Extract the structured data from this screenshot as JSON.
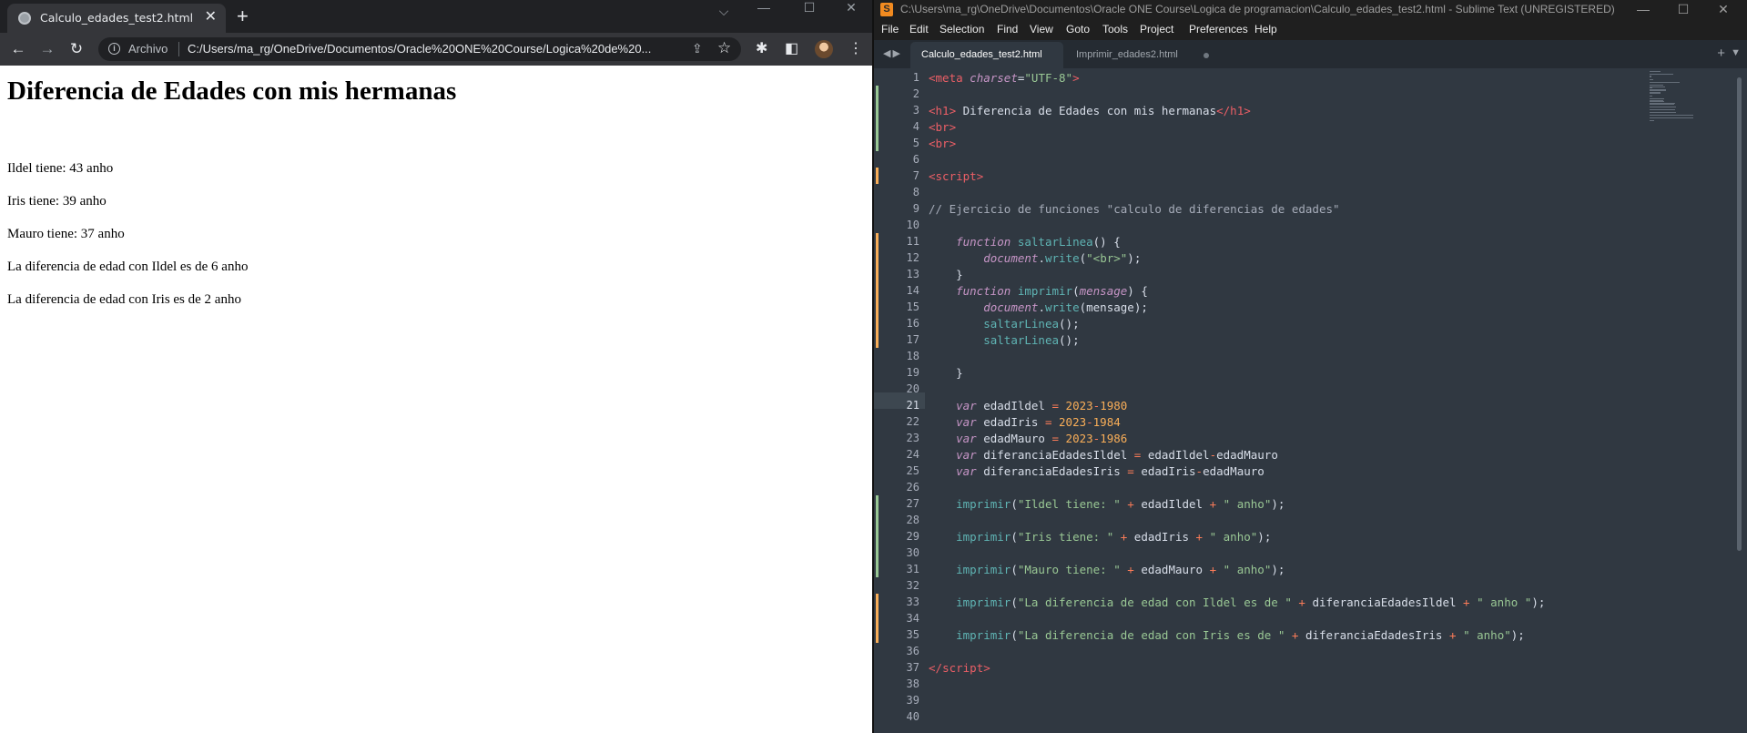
{
  "browser": {
    "tab_title": "Calculo_edades_test2.html",
    "tab_close": "✕",
    "new_tab": "+",
    "window_controls": {
      "minimize": "—",
      "maximize": "☐",
      "close": "✕",
      "tab_search": "⌵"
    },
    "address_chip": "Archivo",
    "address_url": "C:/Users/ma_rg/OneDrive/Documentos/Oracle%20ONE%20Course/Logica%20de%20...",
    "page": {
      "heading": "Diferencia de Edades con mis hermanas",
      "lines": [
        "Ildel tiene: 43 anho",
        "Iris tiene: 39 anho",
        "Mauro tiene: 37 anho",
        "La diferencia de edad con Ildel es de 6 anho",
        "La diferencia de edad con Iris es de 2 anho"
      ]
    }
  },
  "editor": {
    "window_title": "C:\\Users\\ma_rg\\OneDrive\\Documentos\\Oracle ONE Course\\Logica de programacion\\Calculo_edades_test2.html - Sublime Text (UNREGISTERED)",
    "menu": [
      "File",
      "Edit",
      "Selection",
      "Find",
      "View",
      "Goto",
      "Tools",
      "Project",
      "Preferences",
      "Help"
    ],
    "tabs": [
      {
        "label": "Calculo_edades_test2.html",
        "active": true
      },
      {
        "label": "Imprimir_edades2.html",
        "active": false
      }
    ],
    "current_line": 21,
    "line_numbers": [
      "1",
      "2",
      "3",
      "4",
      "5",
      "6",
      "7",
      "8",
      "9",
      "10",
      "11",
      "12",
      "13",
      "14",
      "15",
      "16",
      "17",
      "18",
      "19",
      "20",
      "21",
      "22",
      "23",
      "24",
      "25",
      "26",
      "27",
      "28",
      "29",
      "30",
      "31",
      "32",
      "33",
      "34",
      "35",
      "36",
      "37",
      "38",
      "39",
      "40"
    ],
    "colors": {
      "background": "#303841",
      "tag": "#ec5f66",
      "keyword": "#c695c6",
      "string": "#99c794",
      "function": "#5fb4b4",
      "number": "#f9ae58",
      "operator": "#f97b58",
      "comment": "#a6acb9",
      "gutter_modified": "#f9ae58",
      "gutter_added": "#99c794"
    },
    "code_lines": [
      [
        [
          "tag",
          "<"
        ],
        [
          "tag",
          "meta "
        ],
        [
          "attr",
          "charset"
        ],
        [
          "punc",
          "="
        ],
        [
          "str",
          "\"UTF-8\""
        ],
        [
          "tag",
          ">"
        ]
      ],
      [],
      [
        [
          "tag",
          "<"
        ],
        [
          "tag",
          "h1"
        ],
        [
          "tag",
          ">"
        ],
        [
          "plain",
          " Diferencia de Edades con mis hermanas"
        ],
        [
          "tag",
          "</"
        ],
        [
          "tag",
          "h1"
        ],
        [
          "tag",
          ">"
        ]
      ],
      [
        [
          "tag",
          "<"
        ],
        [
          "tag",
          "br"
        ],
        [
          "tag",
          ">"
        ]
      ],
      [
        [
          "tag",
          "<"
        ],
        [
          "tag",
          "br"
        ],
        [
          "tag",
          ">"
        ]
      ],
      [],
      [
        [
          "tag",
          "<"
        ],
        [
          "tag",
          "script"
        ],
        [
          "tag",
          ">"
        ]
      ],
      [],
      [
        [
          "cmt",
          "// Ejercicio de funciones \"calculo de diferencias de edades\""
        ]
      ],
      [],
      [
        [
          "plain",
          "    "
        ],
        [
          "kw",
          "function"
        ],
        [
          "plain",
          " "
        ],
        [
          "fn",
          "saltarLinea"
        ],
        [
          "punc",
          "() {"
        ]
      ],
      [
        [
          "plain",
          "        "
        ],
        [
          "kw",
          "document"
        ],
        [
          "punc",
          "."
        ],
        [
          "fn",
          "write"
        ],
        [
          "punc",
          "("
        ],
        [
          "str",
          "\"<br>\""
        ],
        [
          "punc",
          ");"
        ]
      ],
      [
        [
          "plain",
          "    "
        ],
        [
          "punc",
          "}"
        ]
      ],
      [
        [
          "plain",
          "    "
        ],
        [
          "kw",
          "function"
        ],
        [
          "plain",
          " "
        ],
        [
          "fn",
          "imprimir"
        ],
        [
          "punc",
          "("
        ],
        [
          "attr",
          "mensage"
        ],
        [
          "punc",
          ") {"
        ]
      ],
      [
        [
          "plain",
          "        "
        ],
        [
          "kw",
          "document"
        ],
        [
          "punc",
          "."
        ],
        [
          "fn",
          "write"
        ],
        [
          "punc",
          "(mensage);"
        ]
      ],
      [
        [
          "plain",
          "        "
        ],
        [
          "fn",
          "saltarLinea"
        ],
        [
          "punc",
          "();"
        ]
      ],
      [
        [
          "plain",
          "        "
        ],
        [
          "fn",
          "saltarLinea"
        ],
        [
          "punc",
          "();"
        ]
      ],
      [],
      [
        [
          "plain",
          "    "
        ],
        [
          "punc",
          "}"
        ]
      ],
      [],
      [
        [
          "plain",
          "    "
        ],
        [
          "kw",
          "var"
        ],
        [
          "plain",
          " edadIldel "
        ],
        [
          "op",
          "="
        ],
        [
          "plain",
          " "
        ],
        [
          "num",
          "2023"
        ],
        [
          "op",
          "-"
        ],
        [
          "num",
          "1980"
        ]
      ],
      [
        [
          "plain",
          "    "
        ],
        [
          "kw",
          "var"
        ],
        [
          "plain",
          " edadIris "
        ],
        [
          "op",
          "="
        ],
        [
          "plain",
          " "
        ],
        [
          "num",
          "2023"
        ],
        [
          "op",
          "-"
        ],
        [
          "num",
          "1984"
        ]
      ],
      [
        [
          "plain",
          "    "
        ],
        [
          "kw",
          "var"
        ],
        [
          "plain",
          " edadMauro "
        ],
        [
          "op",
          "="
        ],
        [
          "plain",
          " "
        ],
        [
          "num",
          "2023"
        ],
        [
          "op",
          "-"
        ],
        [
          "num",
          "1986"
        ]
      ],
      [
        [
          "plain",
          "    "
        ],
        [
          "kw",
          "var"
        ],
        [
          "plain",
          " diferanciaEdadesIldel "
        ],
        [
          "op",
          "="
        ],
        [
          "plain",
          " edadIldel"
        ],
        [
          "op",
          "-"
        ],
        [
          "plain",
          "edadMauro"
        ]
      ],
      [
        [
          "plain",
          "    "
        ],
        [
          "kw",
          "var"
        ],
        [
          "plain",
          " diferanciaEdadesIris "
        ],
        [
          "op",
          "="
        ],
        [
          "plain",
          " edadIris"
        ],
        [
          "op",
          "-"
        ],
        [
          "plain",
          "edadMauro"
        ]
      ],
      [],
      [
        [
          "plain",
          "    "
        ],
        [
          "fn",
          "imprimir"
        ],
        [
          "punc",
          "("
        ],
        [
          "str",
          "\"Ildel tiene: \""
        ],
        [
          "plain",
          " "
        ],
        [
          "op",
          "+"
        ],
        [
          "plain",
          " edadIldel "
        ],
        [
          "op",
          "+"
        ],
        [
          "plain",
          " "
        ],
        [
          "str",
          "\" anho\""
        ],
        [
          "punc",
          ");"
        ]
      ],
      [],
      [
        [
          "plain",
          "    "
        ],
        [
          "fn",
          "imprimir"
        ],
        [
          "punc",
          "("
        ],
        [
          "str",
          "\"Iris tiene: \""
        ],
        [
          "plain",
          " "
        ],
        [
          "op",
          "+"
        ],
        [
          "plain",
          " edadIris "
        ],
        [
          "op",
          "+"
        ],
        [
          "plain",
          " "
        ],
        [
          "str",
          "\" anho\""
        ],
        [
          "punc",
          ");"
        ]
      ],
      [],
      [
        [
          "plain",
          "    "
        ],
        [
          "fn",
          "imprimir"
        ],
        [
          "punc",
          "("
        ],
        [
          "str",
          "\"Mauro tiene: \""
        ],
        [
          "plain",
          " "
        ],
        [
          "op",
          "+"
        ],
        [
          "plain",
          " edadMauro "
        ],
        [
          "op",
          "+"
        ],
        [
          "plain",
          " "
        ],
        [
          "str",
          "\" anho\""
        ],
        [
          "punc",
          ");"
        ]
      ],
      [],
      [
        [
          "plain",
          "    "
        ],
        [
          "fn",
          "imprimir"
        ],
        [
          "punc",
          "("
        ],
        [
          "str",
          "\"La diferencia de edad con Ildel es de \""
        ],
        [
          "plain",
          " "
        ],
        [
          "op",
          "+"
        ],
        [
          "plain",
          " diferanciaEdadesIldel "
        ],
        [
          "op",
          "+"
        ],
        [
          "plain",
          " "
        ],
        [
          "str",
          "\" anho \""
        ],
        [
          "punc",
          ");"
        ]
      ],
      [],
      [
        [
          "plain",
          "    "
        ],
        [
          "fn",
          "imprimir"
        ],
        [
          "punc",
          "("
        ],
        [
          "str",
          "\"La diferencia de edad con Iris es de \""
        ],
        [
          "plain",
          " "
        ],
        [
          "op",
          "+"
        ],
        [
          "plain",
          " diferanciaEdadesIris "
        ],
        [
          "op",
          "+"
        ],
        [
          "plain",
          " "
        ],
        [
          "str",
          "\" anho\""
        ],
        [
          "punc",
          ");"
        ]
      ],
      [],
      [
        [
          "tag",
          "</"
        ],
        [
          "tag",
          "script"
        ],
        [
          "tag",
          ">"
        ]
      ],
      [],
      [],
      []
    ],
    "gutter_marks": {
      "added": [
        2,
        3,
        4,
        5,
        27,
        28,
        29,
        30,
        31
      ],
      "modified": [
        7,
        11,
        12,
        13,
        14,
        15,
        16,
        17,
        33,
        34,
        35
      ]
    }
  }
}
